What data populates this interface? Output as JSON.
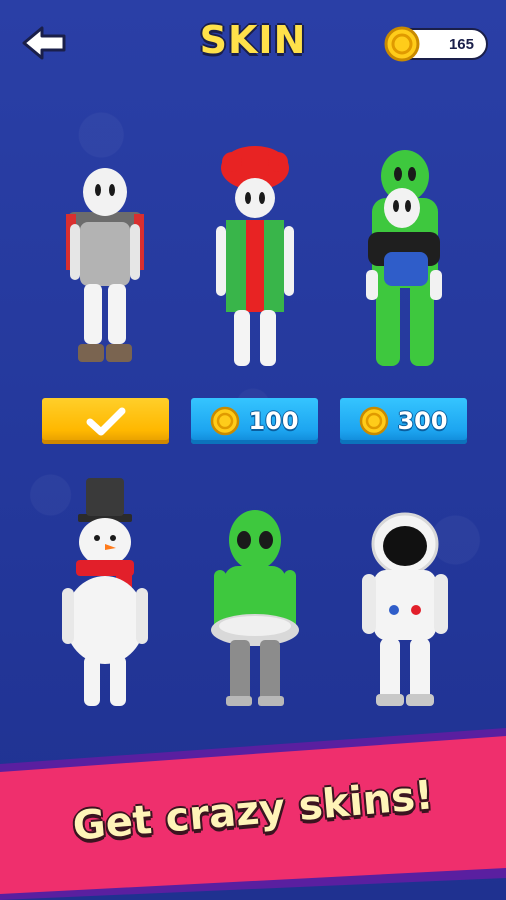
{
  "header": {
    "title": "SKIN",
    "coins": "165"
  },
  "skins": [
    {
      "name": "backpacker",
      "status": "owned"
    },
    {
      "name": "gift-box",
      "price": "100"
    },
    {
      "name": "alien-ride",
      "price": "300"
    },
    {
      "name": "snowman"
    },
    {
      "name": "alien"
    },
    {
      "name": "astronaut"
    }
  ],
  "banner": {
    "text": "Get crazy skins!"
  },
  "colors": {
    "background": "#243a9c",
    "title": "#ffe14a",
    "owned_button": "#ffbe0a",
    "buy_button": "#1da5f0",
    "banner_pink": "#ef2f6d",
    "banner_purple": "#5a1fa0"
  },
  "icons": {
    "back": "back-arrow-icon",
    "coin": "coin-icon",
    "owned": "checkmark-icon"
  }
}
